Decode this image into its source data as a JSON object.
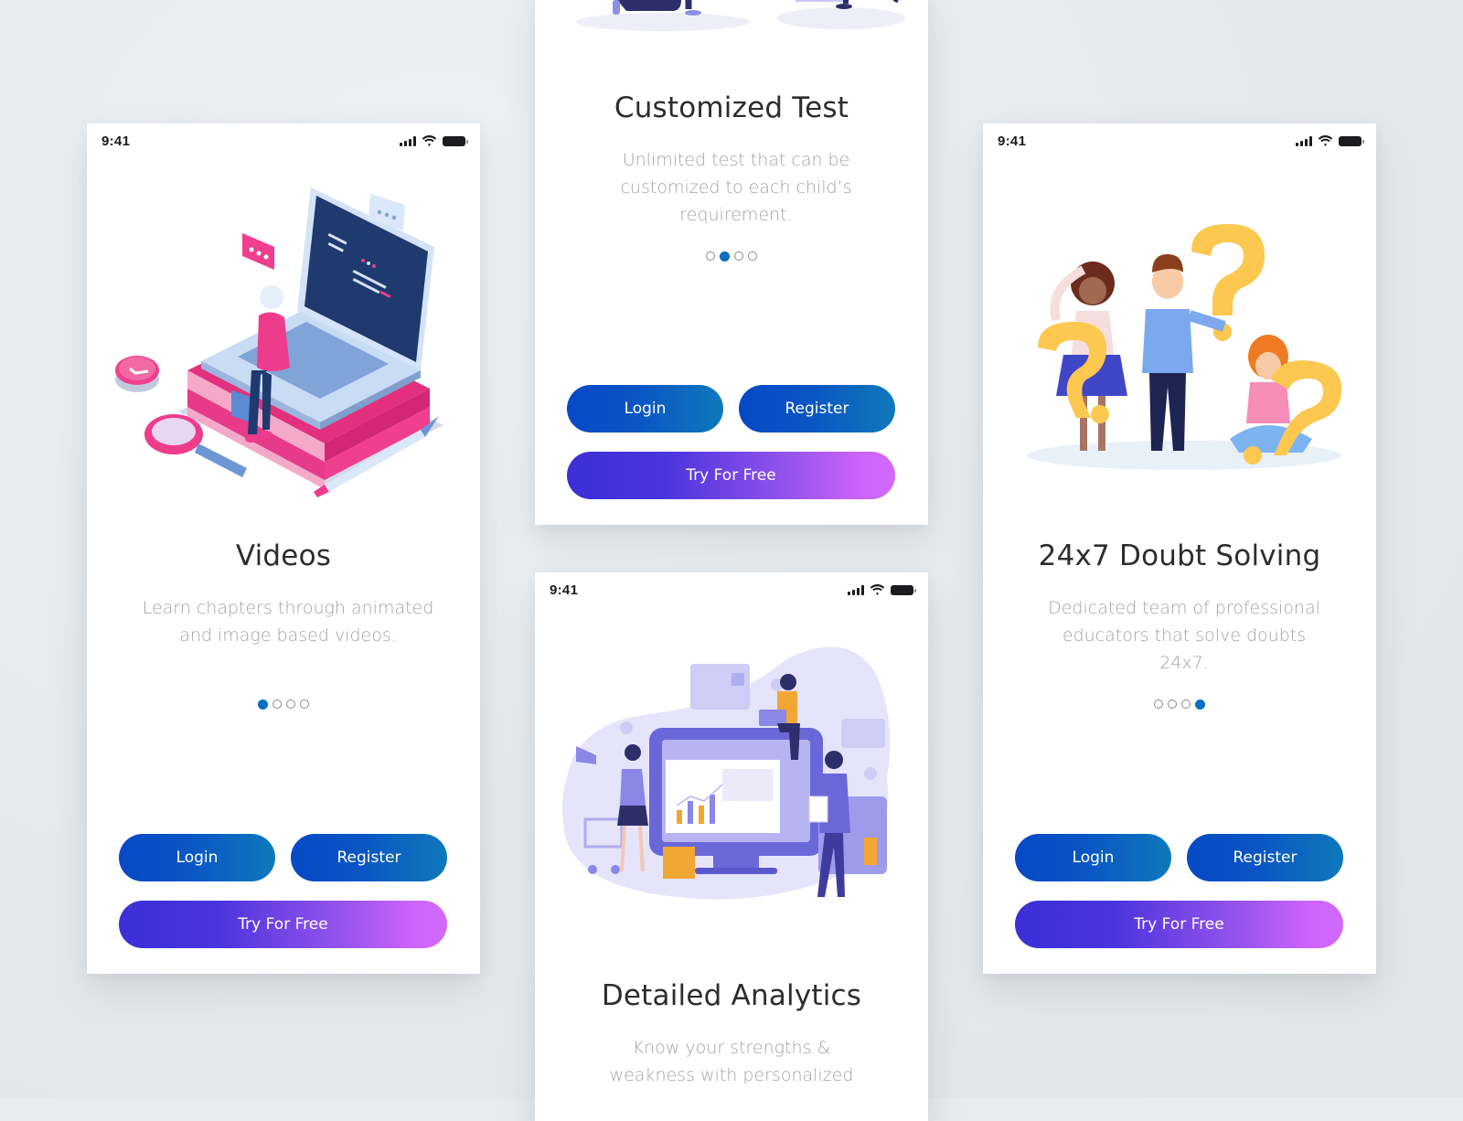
{
  "status_bar": {
    "time": "9:41"
  },
  "colors": {
    "primary_blue": "#0649c6",
    "active_dot": "#0b6ec4",
    "free_gradient_start": "#3a2fd8",
    "free_gradient_end": "#cd63fb",
    "title_text": "#2d2d2d",
    "desc_text": "#a3a3a3"
  },
  "screens": [
    {
      "id": "videos",
      "illustration": "laptop-on-books-illustration",
      "title": "Videos",
      "description": "Learn chapters through animated and image based videos.",
      "page_index": 0,
      "page_count": 4,
      "buttons": {
        "login": "Login",
        "register": "Register",
        "try_free": "Try For Free"
      }
    },
    {
      "id": "customized-test",
      "illustration": "people-kneeling-illustration",
      "title": "Customized Test",
      "description": "Unlimited test that can be customized to each child’s requirement.",
      "page_index": 1,
      "page_count": 4,
      "buttons": {
        "login": "Login",
        "register": "Register",
        "try_free": "Try For Free"
      }
    },
    {
      "id": "detailed-analytics",
      "illustration": "analytics-dashboard-illustration",
      "title": "Detailed Analytics",
      "description": "Know your strengths & weakness with personalized"
    },
    {
      "id": "doubt-solving",
      "illustration": "question-marks-people-illustration",
      "title": "24x7 Doubt Solving",
      "description": "Dedicated team of professional educators that solve doubts 24x7.",
      "page_index": 3,
      "page_count": 4,
      "buttons": {
        "login": "Login",
        "register": "Register",
        "try_free": "Try For Free"
      }
    }
  ]
}
